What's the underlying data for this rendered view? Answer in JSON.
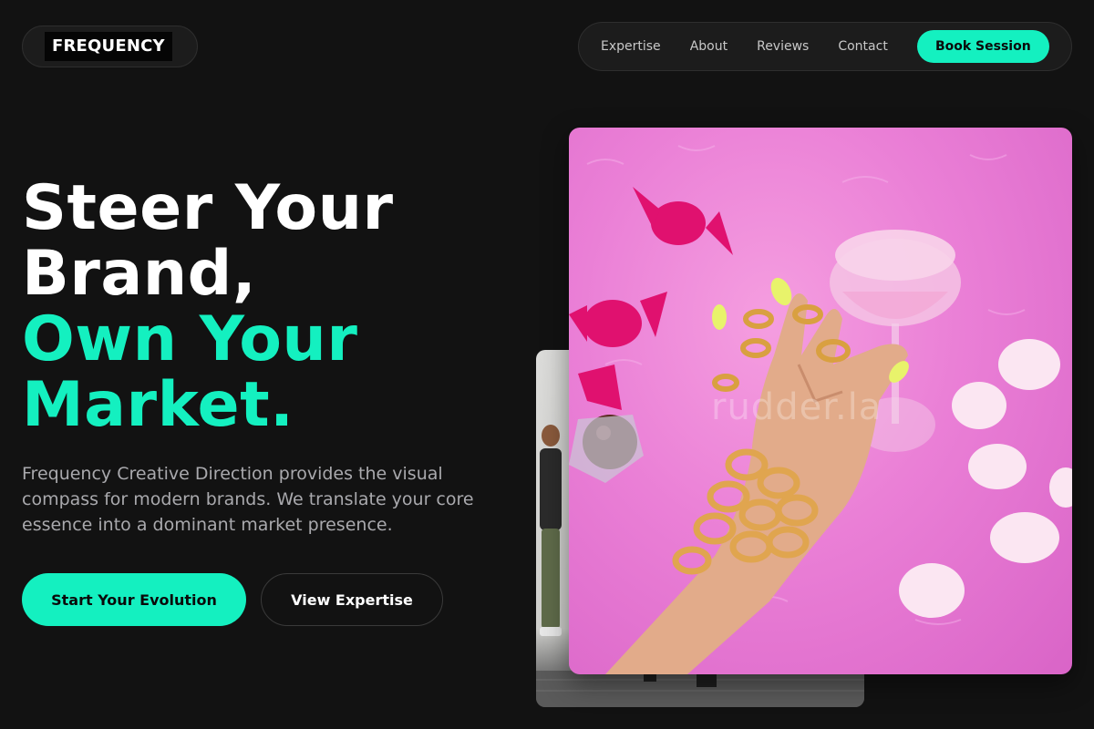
{
  "header": {
    "logo": "FREQUENCY",
    "nav": [
      {
        "label": "Expertise"
      },
      {
        "label": "About"
      },
      {
        "label": "Reviews"
      },
      {
        "label": "Contact"
      }
    ],
    "cta_label": "Book Session"
  },
  "hero": {
    "title_lines": [
      "Steer Your",
      "Brand,"
    ],
    "accent_lines": [
      "Own Your",
      "Market."
    ],
    "description": "Frequency Creative Direction provides the visual compass for modern brands. We translate your core essence into a dominant market presence.",
    "primary_button": "Start Your Evolution",
    "secondary_button": "View Expertise"
  },
  "images": {
    "watermark": "rudder.la"
  },
  "colors": {
    "background": "#121212",
    "accent": "#14f0c0",
    "text": "#ffffff",
    "muted_text": "#a9a9ad"
  }
}
